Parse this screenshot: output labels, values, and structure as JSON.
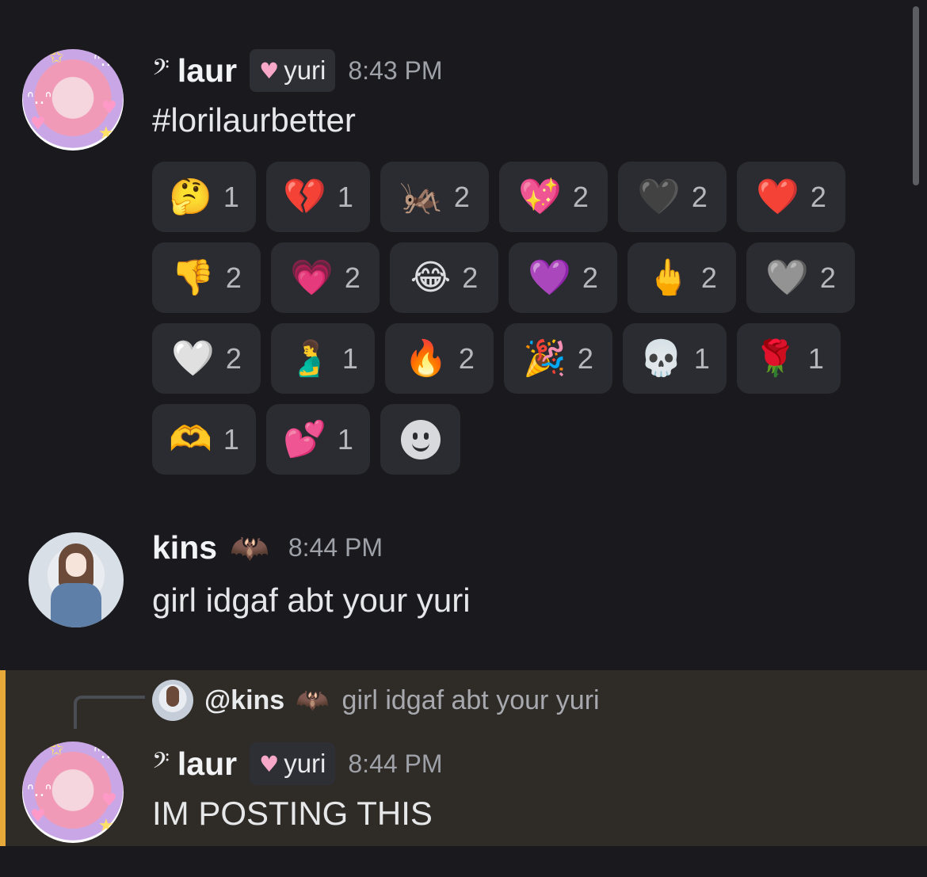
{
  "messages": [
    {
      "username": "laur",
      "role": "yuri",
      "time": "8:43 PM",
      "text": "#lorilaurbetter",
      "reactions": [
        [
          {
            "emoji": "🤔",
            "count": "1"
          },
          {
            "emoji": "💔",
            "count": "1"
          },
          {
            "emoji": "🦗",
            "count": "2"
          },
          {
            "emoji": "💖",
            "count": "2"
          },
          {
            "emoji": "🖤",
            "count": "2"
          },
          {
            "emoji": "❤️",
            "count": "2"
          }
        ],
        [
          {
            "emoji": "👎",
            "count": "2"
          },
          {
            "emoji": "💗",
            "count": "2"
          },
          {
            "emoji": "😂",
            "count": "2"
          },
          {
            "emoji": "💜",
            "count": "2"
          },
          {
            "emoji": "🖕",
            "count": "2"
          },
          {
            "emoji": "🩶",
            "count": "2"
          }
        ],
        [
          {
            "emoji": "🤍",
            "count": "2"
          },
          {
            "emoji": "🫃",
            "count": "1"
          },
          {
            "emoji": "🔥",
            "count": "2"
          },
          {
            "emoji": "🎉",
            "count": "2"
          },
          {
            "emoji": "💀",
            "count": "1"
          },
          {
            "emoji": "🌹",
            "count": "1"
          }
        ],
        [
          {
            "emoji": "🫶",
            "count": "1"
          },
          {
            "emoji": "💕",
            "count": "1"
          }
        ]
      ]
    },
    {
      "username": "kins",
      "time": "8:44 PM",
      "text": "girl idgaf abt your yuri"
    },
    {
      "reply": {
        "mention": "@kins",
        "text": "girl idgaf abt your yuri"
      },
      "username": "laur",
      "role": "yuri",
      "time": "8:44 PM",
      "text": "IM POSTING THIS"
    }
  ],
  "icons": {
    "clef": "bass-clef-icon",
    "role": "pink-heart-icon",
    "kins_badge": "bat-icon",
    "add_reaction": "add-reaction-smiley-icon"
  },
  "colors": {
    "background": "#1a1a1e",
    "highlight": "#2f2b27",
    "highlight_bar": "#e6a93a",
    "reaction_bg": "#2b2c31"
  }
}
